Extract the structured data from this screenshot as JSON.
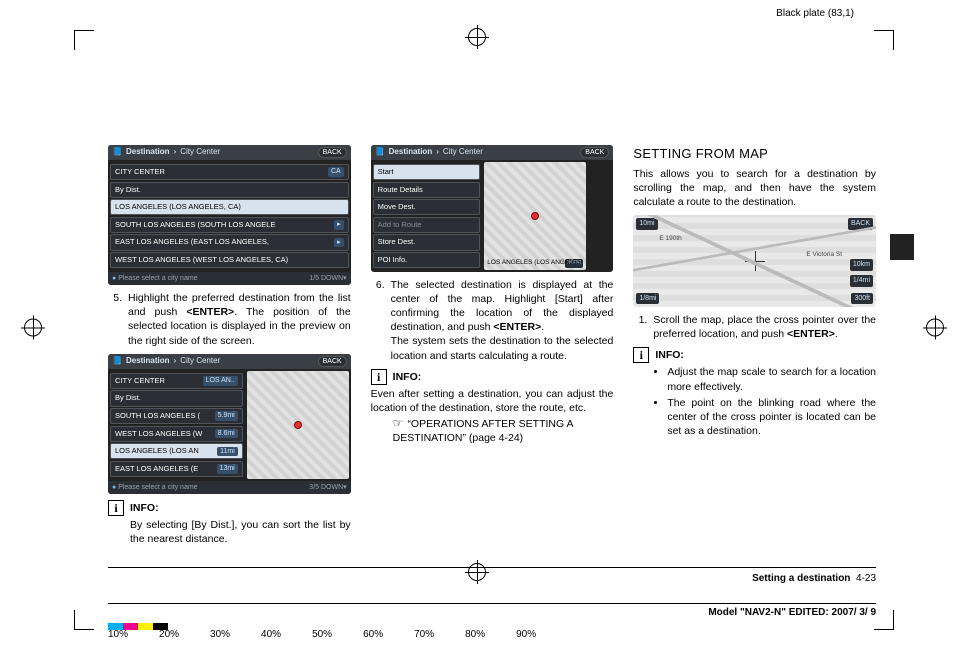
{
  "plate_label": "Black plate (83,1)",
  "col1": {
    "shot1": {
      "breadcrumb_a": "Destination",
      "breadcrumb_b": "City Center",
      "back": "BACK",
      "header_row": "CITY CENTER",
      "header_sub": "CA",
      "sort": "By Dist.",
      "rows": [
        "LOS ANGELES (LOS ANGELES, CA)",
        "SOUTH LOS ANGELES (SOUTH LOS ANGELE",
        "EAST LOS ANGELES (EAST LOS ANGELES,",
        "WEST LOS ANGELES (WEST LOS ANGELES, CA)"
      ],
      "page": "1/5",
      "down": "DOWN",
      "hint": "Please select a city name"
    },
    "step5_num": "5.",
    "step5_a": "Highlight the preferred destination from the list and push ",
    "step5_enter": "<ENTER>",
    "step5_b": ". The position of the selected location is displayed in the preview on the right side of the screen.",
    "shot2": {
      "breadcrumb_a": "Destination",
      "breadcrumb_b": "City Center",
      "back": "BACK",
      "header_row": "CITY CENTER",
      "header_sub": "LOS AN..",
      "sort": "By Dist.",
      "rows": [
        {
          "t": "SOUTH LOS ANGELES (",
          "d": "5.9mi"
        },
        {
          "t": "WEST LOS ANGELES (W",
          "d": "8.6mi"
        },
        {
          "t": "LOS ANGELES (LOS AN",
          "d": "11mi",
          "sel": true
        },
        {
          "t": "EAST LOS ANGELES (E",
          "d": "13mi"
        }
      ],
      "page": "3/5",
      "down": "DOWN",
      "hint": "Please select a city name"
    },
    "info_label": "INFO:",
    "info_body": "By selecting [By Dist.], you can sort the list by the nearest distance."
  },
  "col2": {
    "shot": {
      "breadcrumb_a": "Destination",
      "breadcrumb_b": "City Center",
      "back": "BACK",
      "menu": [
        "Start",
        "Route Details",
        "Move Dest.",
        "Add to Route",
        "Store Dest.",
        "POI Info."
      ],
      "sel_index": 0,
      "muted_index": 3,
      "caption": "LOS ANGELES (LOS ANGELES",
      "scale": "300ft"
    },
    "step6_num": "6.",
    "step6_a": "The selected destination is displayed at the center of the map. Highlight [Start] after confirming the location of the displayed destination, and push ",
    "step6_enter": "<ENTER>",
    "step6_b": ".",
    "step6_c": "The system sets the destination to the selected location and starts calculating a route.",
    "info_label": "INFO:",
    "info_body": "Even after setting a destination, you can adjust the location of the destination, store the route, etc.",
    "xref": "“OPERATIONS AFTER SETTING A DESTINATION” (page 4-24)"
  },
  "col3": {
    "heading": "SETTING FROM MAP",
    "intro": "This allows you to search for a destination by scrolling the map, and then have the system calculate a route to the destination.",
    "map": {
      "tl": "10mi",
      "tr": "BACK",
      "bl": "1/8mi",
      "br_scale": "300ft",
      "street1": "E Victoria St",
      "street2": "E 190th",
      "side1": "10km",
      "side2": "1/4mi"
    },
    "step1_num": "1.",
    "step1_a": "Scroll the map, place the cross pointer over the preferred location, and push ",
    "step1_enter": "<ENTER>",
    "step1_b": ".",
    "info_label": "INFO:",
    "bullet1": "Adjust the map scale to search for a location more effectively.",
    "bullet2": "The point on the blinking road where the center of the cross pointer is located can be set as a destination."
  },
  "footer": {
    "section": "Setting a destination",
    "page": "4-23",
    "model": "Model \"NAV2-N\" EDITED: 2007/ 3/ 9"
  },
  "percents": [
    "10%",
    "20%",
    "30%",
    "40%",
    "50%",
    "60%",
    "70%",
    "80%",
    "90%"
  ],
  "swatches": [
    "#00aeef",
    "#ec008c",
    "#fff200",
    "#000000"
  ]
}
